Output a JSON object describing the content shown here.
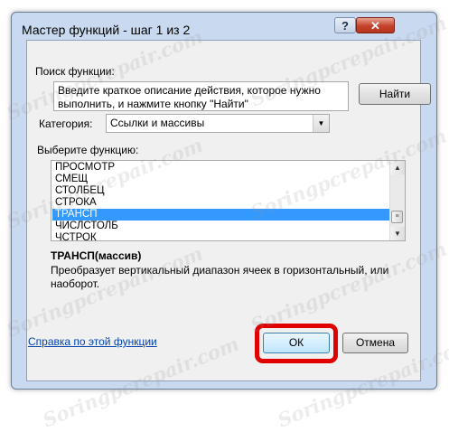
{
  "dialog": {
    "title": "Мастер функций - шаг 1 из 2",
    "help_glyph": "?",
    "close_glyph": "✕"
  },
  "search": {
    "label": "Поиск функции:",
    "description": "Введите краткое описание действия, которое нужно выполнить, и нажмите кнопку \"Найти\"",
    "find_button": "Найти"
  },
  "category": {
    "label": "Категория:",
    "selected": "Ссылки и массивы"
  },
  "function_list": {
    "label": "Выберите функцию:",
    "items": [
      "ПРОСМОТР",
      "СМЕЩ",
      "СТОЛБЕЦ",
      "СТРОКА",
      "ТРАНСП",
      "ЧИСЛСТОЛБ",
      "ЧСТРОК"
    ],
    "selected_index": 4
  },
  "selected_function": {
    "syntax": "ТРАНСП(массив)",
    "description": "Преобразует вертикальный диапазон ячеек в горизонтальный, или наоборот."
  },
  "footer": {
    "help_link": "Справка по этой функции",
    "ok_button": "ОК",
    "cancel_button": "Отмена"
  },
  "watermark": "Soringpcrepair.com",
  "colors": {
    "selection": "#3399ff",
    "highlight_ring": "#e00000",
    "link": "#0645ad"
  }
}
